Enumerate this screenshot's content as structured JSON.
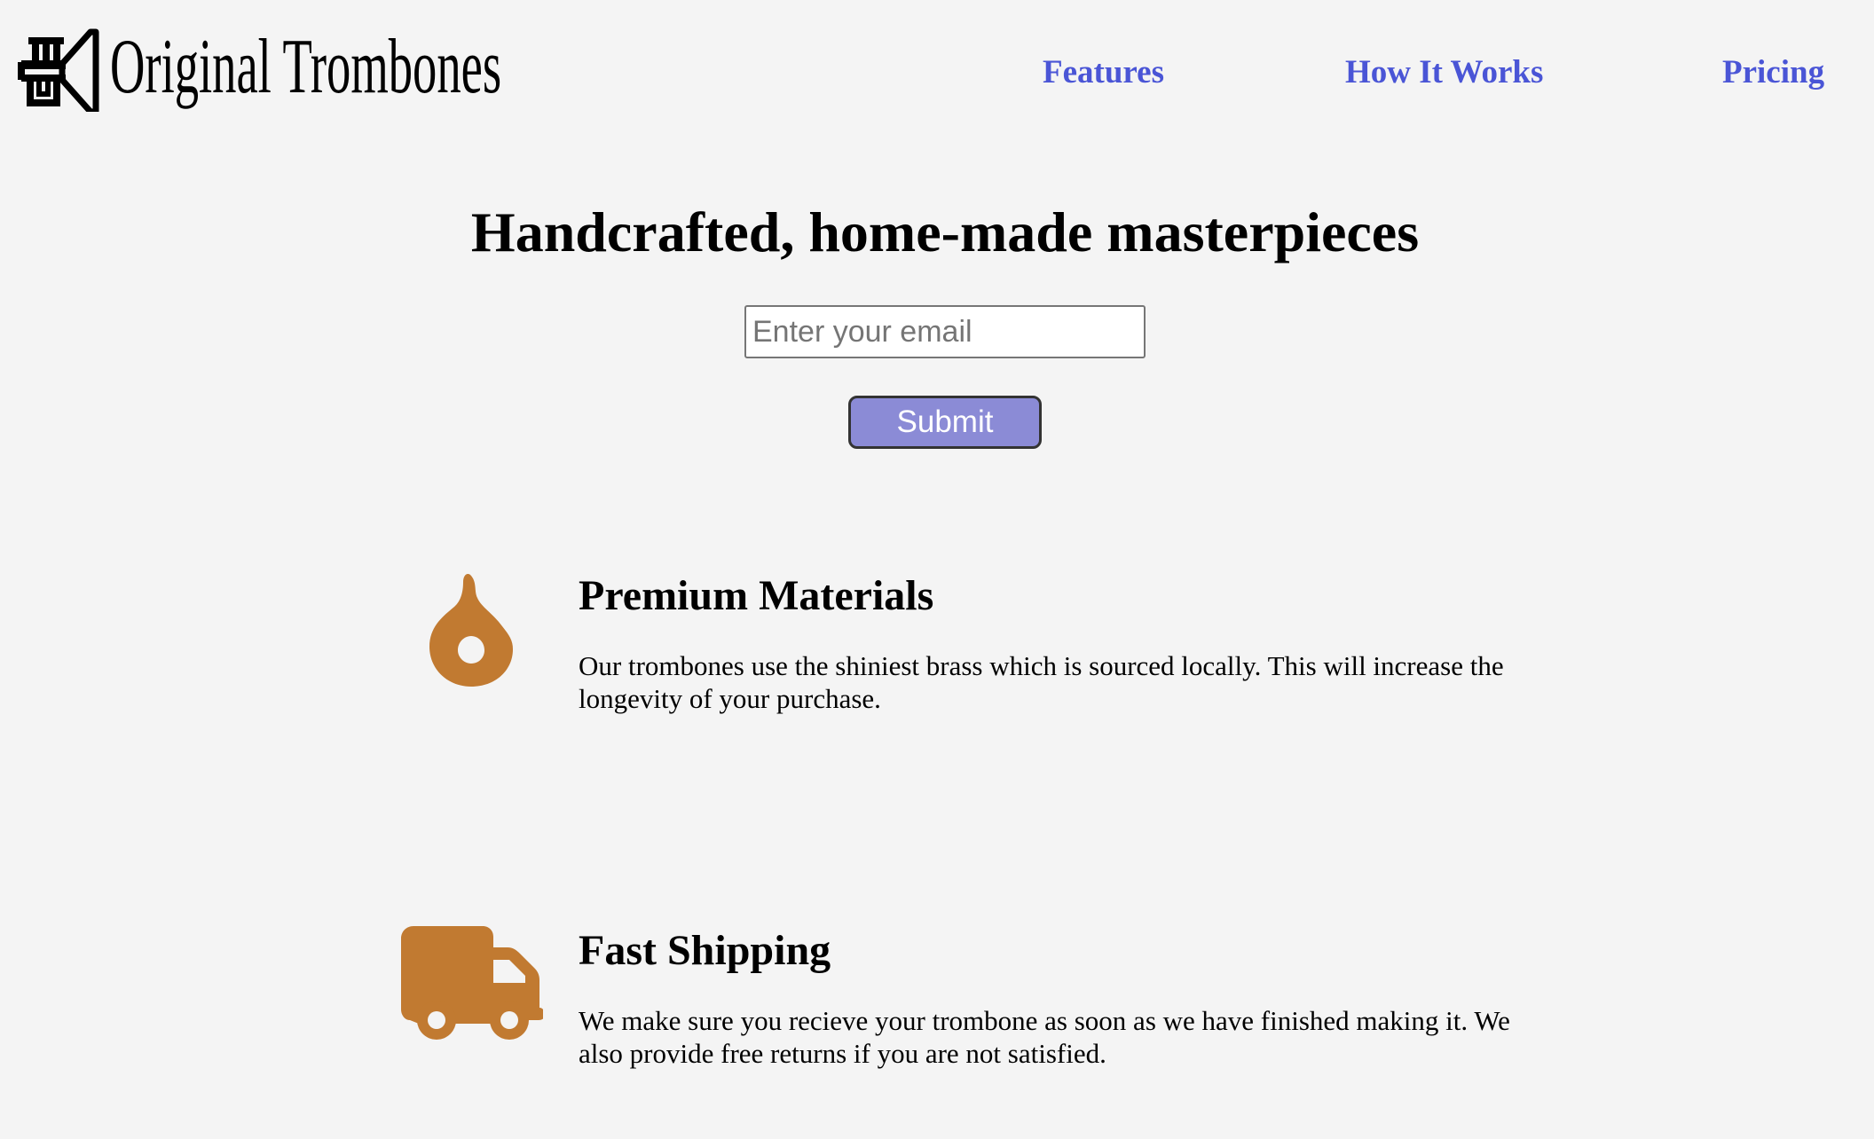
{
  "brand": {
    "name": "Original Trombones",
    "logo_icon": "trumpet-icon"
  },
  "nav": {
    "features": "Features",
    "how_it_works": "How It Works",
    "pricing": "Pricing"
  },
  "hero": {
    "title": "Handcrafted, home-made masterpieces",
    "email_placeholder": "Enter your email",
    "email_value": "",
    "submit_label": "Submit"
  },
  "features": [
    {
      "icon": "fire-icon",
      "title": "Premium Materials",
      "text": "Our trombones use the shiniest brass which is sourced locally. This will increase the longevity of your purchase."
    },
    {
      "icon": "truck-icon",
      "title": "Fast Shipping",
      "text": "We make sure you recieve your trombone as soon as we have finished making it. We also provide free returns if you are not satisfied."
    }
  ],
  "colors": {
    "background": "#f4f4f4",
    "nav_link": "#4a55d6",
    "button_bg": "#8b8bd6",
    "icon_accent": "#c17a31"
  }
}
